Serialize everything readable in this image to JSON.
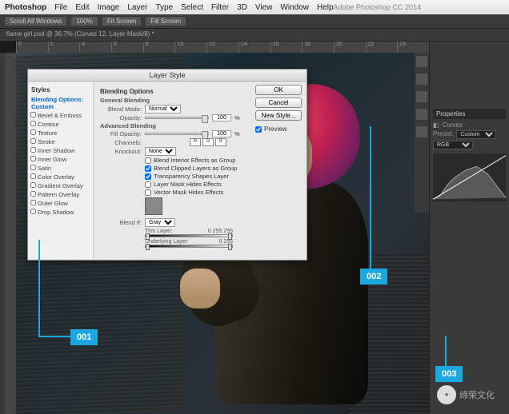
{
  "menubar": {
    "app": "Photoshop",
    "items": [
      "File",
      "Edit",
      "Image",
      "Layer",
      "Type",
      "Select",
      "Filter",
      "3D",
      "View",
      "Window",
      "Help"
    ]
  },
  "titlebar": "Adobe Photoshop CC 2014",
  "optbar": [
    "Scroll All Windows",
    "100%",
    "Fit Screen",
    "Fill Screen"
  ],
  "doctab": "flame girl.psd @ 36.7% (Curves 12, Layer Mask/8) *",
  "ruler": [
    "0",
    "2",
    "4",
    "6",
    "8",
    "10",
    "12",
    "14",
    "16",
    "18",
    "20",
    "22",
    "24"
  ],
  "dialog": {
    "title": "Layer Style",
    "side_header": "Styles",
    "side_selected": "Blending Options: Custom",
    "side_items": [
      "Bevel & Emboss",
      "Contour",
      "Texture",
      "Stroke",
      "Inner Shadow",
      "Inner Glow",
      "Satin",
      "Color Overlay",
      "Gradient Overlay",
      "Pattern Overlay",
      "Outer Glow",
      "Drop Shadow"
    ],
    "section": "Blending Options",
    "general": "General Blending",
    "blend_mode_label": "Blend Mode:",
    "blend_mode": "Normal",
    "opacity_label": "Opacity:",
    "opacity": "100",
    "pct": "%",
    "advanced": "Advanced Blending",
    "fill_label": "Fill Opacity:",
    "fill": "100",
    "channels_label": "Channels:",
    "channels": [
      "R",
      "G",
      "B"
    ],
    "knockout_label": "Knockout:",
    "knockout": "None",
    "checks": [
      "Blend Interior Effects as Group",
      "Blend Clipped Layers as Group",
      "Transparency Shapes Layer",
      "Layer Mask Hides Effects",
      "Vector Mask Hides Effects"
    ],
    "blendif_label": "Blend If:",
    "blendif": "Gray",
    "this_layer": "This Layer:",
    "this_vals": "0    255    255",
    "under_layer": "Underlying Layer:",
    "under_vals": "0         255",
    "buttons": {
      "ok": "OK",
      "cancel": "Cancel",
      "new": "New Style...",
      "preview": "Preview"
    }
  },
  "properties": {
    "title": "Properties",
    "type": "Curves",
    "preset_label": "Preset:",
    "preset": "Custom",
    "channel": "RGB"
  },
  "callouts": {
    "c1": "001",
    "c2": "002",
    "c3": "003"
  },
  "watermark": "缔荣文化"
}
